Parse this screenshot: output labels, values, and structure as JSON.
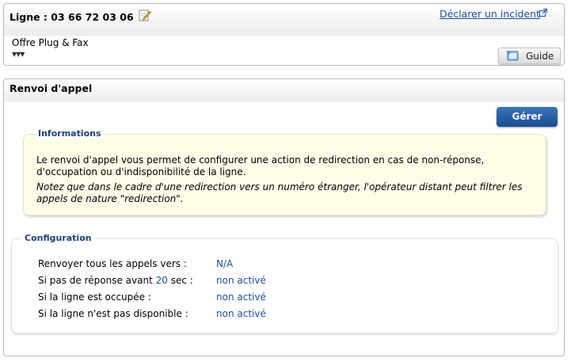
{
  "line_panel": {
    "title": "Ligne : 03 66 72 03 06",
    "report_link": "Déclarer un incident",
    "offer": "Offre Plug & Fax",
    "expand_glyph": "▼▼▼",
    "guide_button": "Guide"
  },
  "forward_panel": {
    "title": "Renvoi d'appel",
    "manage_button": "Gérer",
    "info": {
      "legend": "Informations",
      "text": "Le renvoi d'appel vous permet de configurer une action de redirection en cas de non-réponse, d'occupation ou d'indisponibilité de la ligne.",
      "note": "Notez que dans le cadre d'une redirection vers un numéro étranger, l'opérateur distant peut filtrer les appels de nature \"redirection\"."
    },
    "config": {
      "legend": "Configuration",
      "rows": [
        {
          "label": "Renvoyer tous les appels vers :",
          "value": "N/A"
        },
        {
          "label_pre": "Si pas de réponse avant ",
          "delay": "20",
          "label_post": " sec :",
          "value": "non activé"
        },
        {
          "label": "Si la ligne est occupée :",
          "value": "non activé"
        },
        {
          "label": "Si la ligne n'est pas disponible :",
          "value": "non activé"
        }
      ]
    }
  },
  "colors": {
    "link": "#1f4e9c",
    "manage_button": "#245a9c",
    "info_background": "#fdfde8"
  }
}
